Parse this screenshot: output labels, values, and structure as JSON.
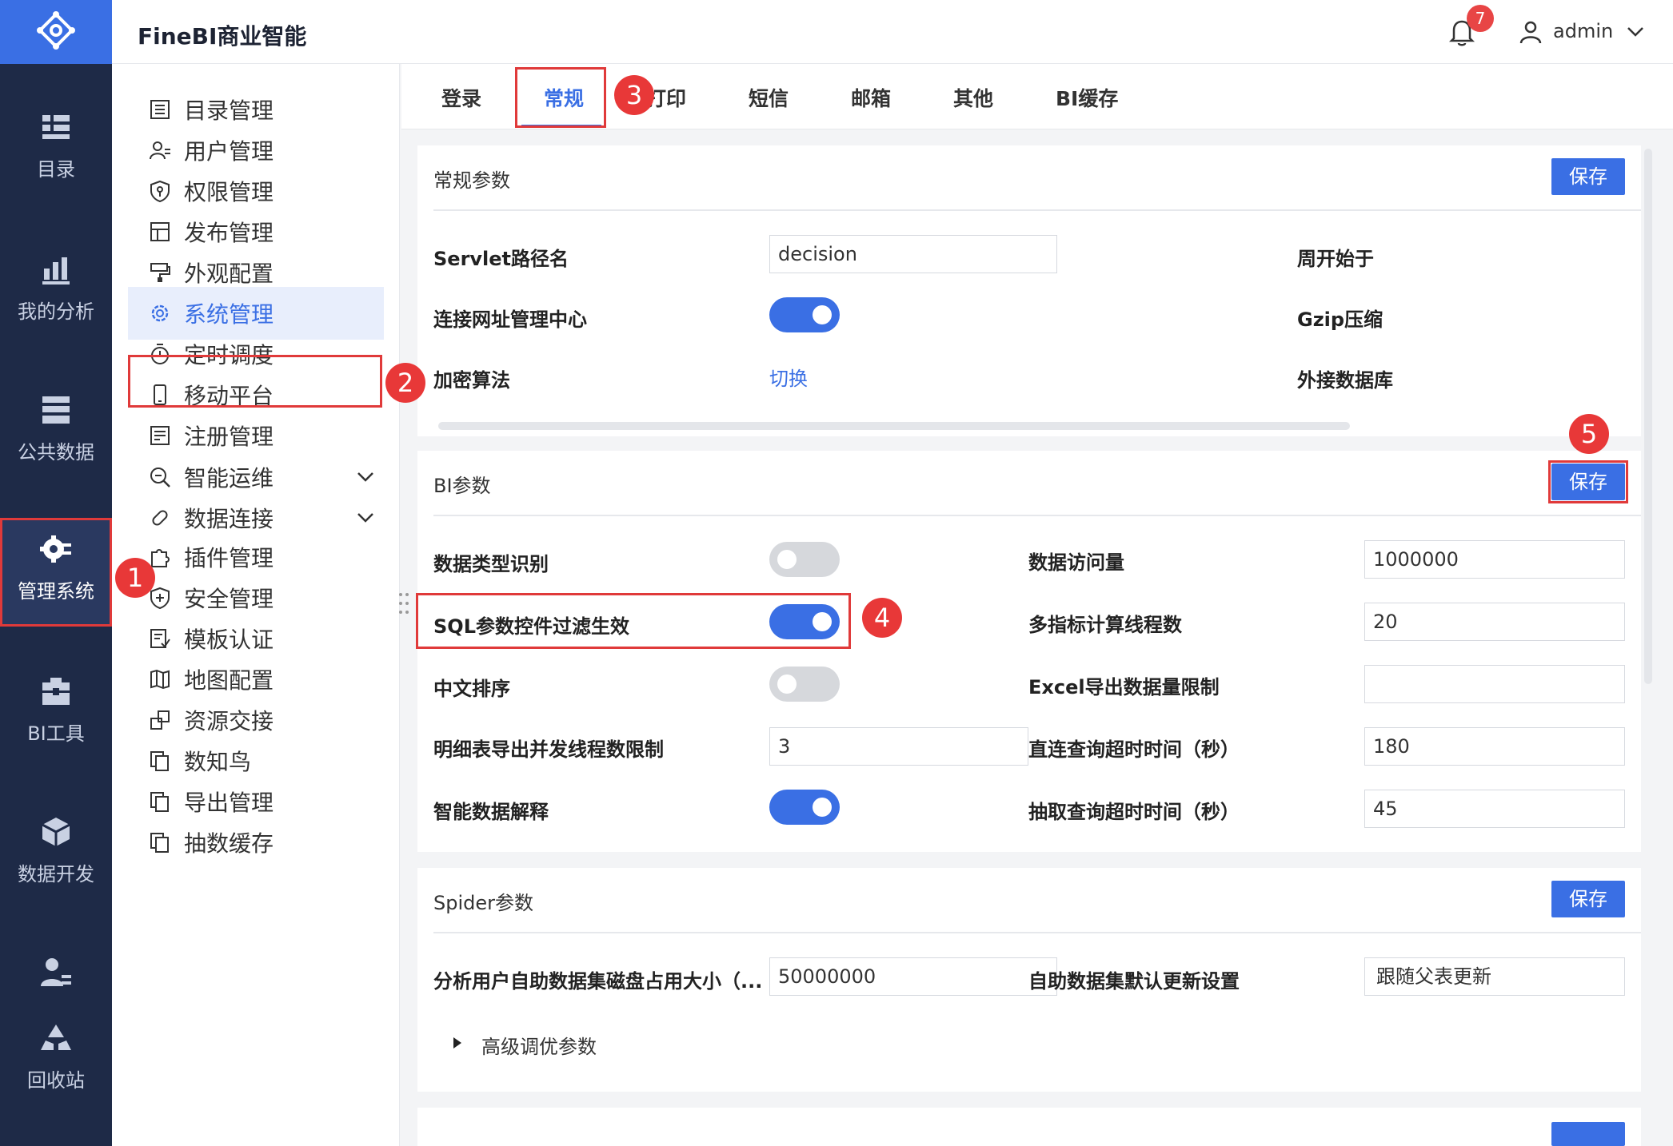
{
  "app": {
    "title": "FineBI商业智能"
  },
  "header": {
    "notification_count": "7",
    "user_name": "admin"
  },
  "rail": [
    {
      "label": "目录",
      "icon": "catalog-icon"
    },
    {
      "label": "我的分析",
      "icon": "analysis-chart-icon"
    },
    {
      "label": "公共数据",
      "icon": "public-data-icon"
    },
    {
      "label": "管理系统",
      "icon": "management-gear-icon",
      "active": true
    },
    {
      "label": "BI工具",
      "icon": "toolbox-icon"
    },
    {
      "label": "数据开发",
      "icon": "data-dev-cube-icon"
    },
    {
      "label": "回收站",
      "icon": "recycle-bin-icon"
    }
  ],
  "menu": [
    {
      "label": "目录管理",
      "icon": "list-icon"
    },
    {
      "label": "用户管理",
      "icon": "user-icon"
    },
    {
      "label": "权限管理",
      "icon": "shield-key-icon"
    },
    {
      "label": "发布管理",
      "icon": "publish-icon"
    },
    {
      "label": "外观配置",
      "icon": "paint-roller-icon"
    },
    {
      "label": "系统管理",
      "icon": "gear-icon",
      "active": true
    },
    {
      "label": "定时调度",
      "icon": "timer-icon"
    },
    {
      "label": "移动平台",
      "icon": "mobile-icon"
    },
    {
      "label": "注册管理",
      "icon": "register-icon"
    },
    {
      "label": "智能运维",
      "icon": "ops-icon",
      "expandable": true
    },
    {
      "label": "数据连接",
      "icon": "link-icon",
      "expandable": true
    },
    {
      "label": "插件管理",
      "icon": "plugin-icon"
    },
    {
      "label": "安全管理",
      "icon": "security-icon"
    },
    {
      "label": "模板认证",
      "icon": "template-cert-icon"
    },
    {
      "label": "地图配置",
      "icon": "map-icon"
    },
    {
      "label": "资源交接",
      "icon": "handover-icon"
    },
    {
      "label": "数知鸟",
      "icon": "copy-icon"
    },
    {
      "label": "导出管理",
      "icon": "copy-icon"
    },
    {
      "label": "抽数缓存",
      "icon": "copy-icon"
    }
  ],
  "tabs": [
    "登录",
    "常规",
    "打印",
    "短信",
    "邮箱",
    "其他",
    "BI缓存"
  ],
  "general": {
    "title": "常规参数",
    "save": "保存",
    "servlet_label": "Servlet路径名",
    "servlet_value": "decision",
    "week_start_label": "周开始于",
    "connect_center_label": "连接网址管理中心",
    "connect_center_on": true,
    "gzip_label": "Gzip压缩",
    "encrypt_label": "加密算法",
    "encrypt_link": "切换",
    "external_db_label": "外接数据库"
  },
  "bi": {
    "title": "BI参数",
    "save": "保存",
    "datatype_label": "数据类型识别",
    "datatype_on": false,
    "access_label": "数据访问量",
    "access_value": "1000000",
    "sql_filter_label": "SQL参数控件过滤生效",
    "sql_filter_on": true,
    "threads_label": "多指标计算线程数",
    "threads_value": "20",
    "cn_sort_label": "中文排序",
    "cn_sort_on": false,
    "excel_limit_label": "Excel导出数据量限制",
    "excel_limit_value": "",
    "detail_threads_label": "明细表导出并发线程数限制",
    "detail_threads_value": "3",
    "direct_timeout_label": "直连查询超时时间（秒）",
    "direct_timeout_value": "180",
    "smart_explain_label": "智能数据解释",
    "smart_explain_on": true,
    "extract_timeout_label": "抽取查询超时时间（秒）",
    "extract_timeout_value": "45"
  },
  "spider": {
    "title": "Spider参数",
    "save": "保存",
    "disk_label": "分析用户自助数据集磁盘占用大小（...",
    "disk_value": "50000000",
    "update_label": "自助数据集默认更新设置",
    "update_value": "跟随父表更新",
    "advanced_label": "高级调优参数"
  },
  "annotations": [
    "1",
    "2",
    "3",
    "4",
    "5"
  ],
  "colors": {
    "primary": "#3a6fe4",
    "rail_bg": "#1e2a47",
    "annotation_red": "#e03a3a"
  }
}
